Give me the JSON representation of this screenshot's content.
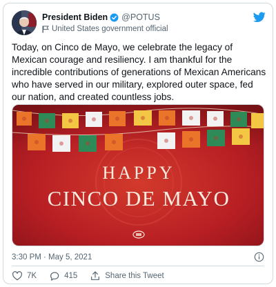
{
  "tweet": {
    "author": {
      "display_name": "President Biden",
      "handle": "@POTUS",
      "label": "United States government official"
    },
    "icons": {
      "verified": "verified-badge-icon",
      "government": "flag-icon",
      "brand": "twitter-bird-icon",
      "info": "info-icon"
    },
    "text": "Today, on Cinco de Mayo, we celebrate the legacy of Mexican courage and resiliency. I am thankful for the incredible contributions of generations of Mexican Americans who have served in our military, explored outer space, fed our nation, and created countless jobs.",
    "media": {
      "line1": "HAPPY",
      "line2": "CINCO DE MAYO"
    },
    "timestamp": "3:30 PM · May 5, 2021",
    "actions": {
      "likes": "7K",
      "replies": "415",
      "share_label": "Share this Tweet"
    },
    "colors": {
      "accent": "#1d9bf0",
      "text": "#0f1419",
      "secondary": "#536471",
      "banner_red": "#b81f24"
    }
  }
}
